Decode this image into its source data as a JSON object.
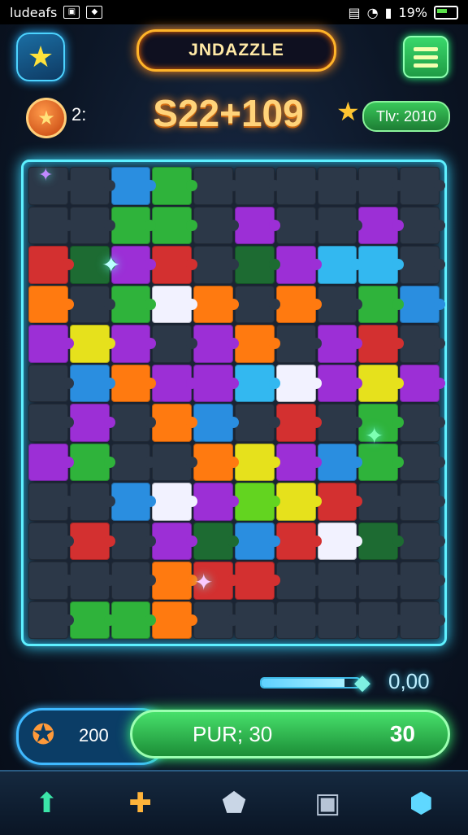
{
  "status_bar": {
    "left_text": "ludeafs",
    "battery": "19%"
  },
  "header": {
    "title": "JNDAZZLE",
    "star_icon": "star-icon",
    "menu_icon": "menu-icon"
  },
  "stats": {
    "coins": "2:",
    "score": "S22+109",
    "time": "Tlv: 2010"
  },
  "board": {
    "rows": 12,
    "cols": 10,
    "colors": {
      "G": "#2fb33b",
      "P": "#9c2fd6",
      "O": "#ff7a10",
      "Y": "#e6e11c",
      "R": "#d33030",
      "B": "#2a8ee0",
      "C": "#33b8f0",
      "W": "#f2f2ff",
      "D": "#2c3848",
      "L": "#63d420",
      "E": "#1d6b32"
    },
    "layout": [
      "DDBGDDDDDD",
      "DDGGDPDDPD",
      "REPRDEPCCD",
      "ODGWODODGB",
      "PYPDPODPRD",
      "DBOPPCWPYP",
      "DPDOBDRDGD",
      "PGDDOYPBGD",
      "DDBWPLYRDD",
      "DRDPEBRWED",
      "DDDORRDDDD",
      "DGGODDDDDD"
    ]
  },
  "progress": {
    "value": "0,00",
    "fraction": 0.85
  },
  "action_bar": {
    "left_value": "200",
    "button_label": "PUR; 30",
    "button_value": "30"
  },
  "nav": [
    {
      "icon": "up-arrow-icon"
    },
    {
      "icon": "puzzle-icon"
    },
    {
      "icon": "shield-icon"
    },
    {
      "icon": "backpack-icon"
    },
    {
      "icon": "cube-icon"
    }
  ]
}
